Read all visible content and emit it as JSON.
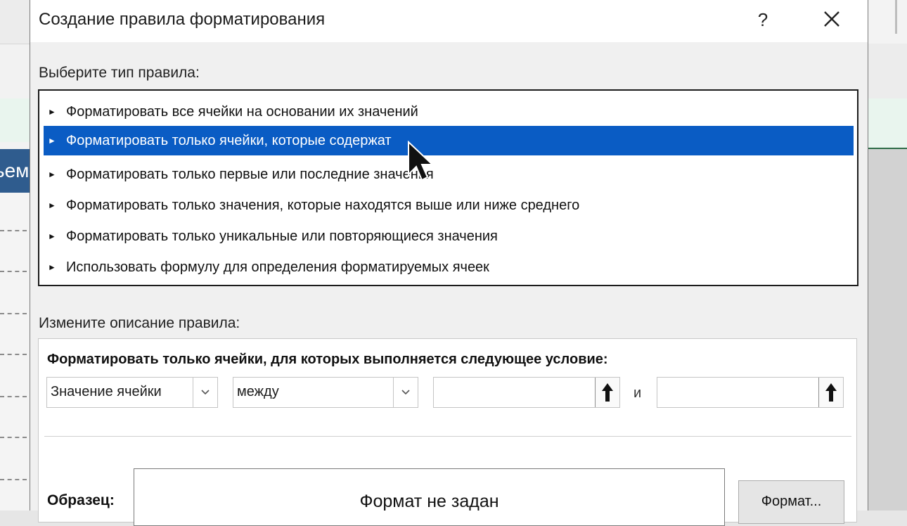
{
  "dialog": {
    "title": "Создание правила форматирования",
    "help_label": "?"
  },
  "rule_type": {
    "label": "Выберите тип правила:",
    "items": [
      {
        "label": "Форматировать все ячейки на основании их значений",
        "selected": false
      },
      {
        "label": "Форматировать только ячейки, которые содержат",
        "selected": true
      },
      {
        "label": "Форматировать только первые или последние значения",
        "selected": false
      },
      {
        "label": "Форматировать только значения, которые находятся выше или ниже среднего",
        "selected": false
      },
      {
        "label": "Форматировать только уникальные или повторяющиеся значения",
        "selected": false
      },
      {
        "label": "Использовать формулу для определения форматируемых ячеек",
        "selected": false
      }
    ]
  },
  "rule_description": {
    "label": "Измените описание правила:",
    "condition_title": "Форматировать только ячейки, для которых выполняется следующее условие:",
    "field_select": "Значение ячейки",
    "operator_select": "между",
    "value1": "",
    "and_label": "и",
    "value2": "",
    "sample_label": "Образец:",
    "preview_text": "Формат не задан",
    "format_button": "Формат..."
  },
  "background": {
    "sheet_tab_fragment": "ьем"
  },
  "colors": {
    "selection": "#0a5cc4",
    "dialog_bg": "#f0f0f0"
  }
}
